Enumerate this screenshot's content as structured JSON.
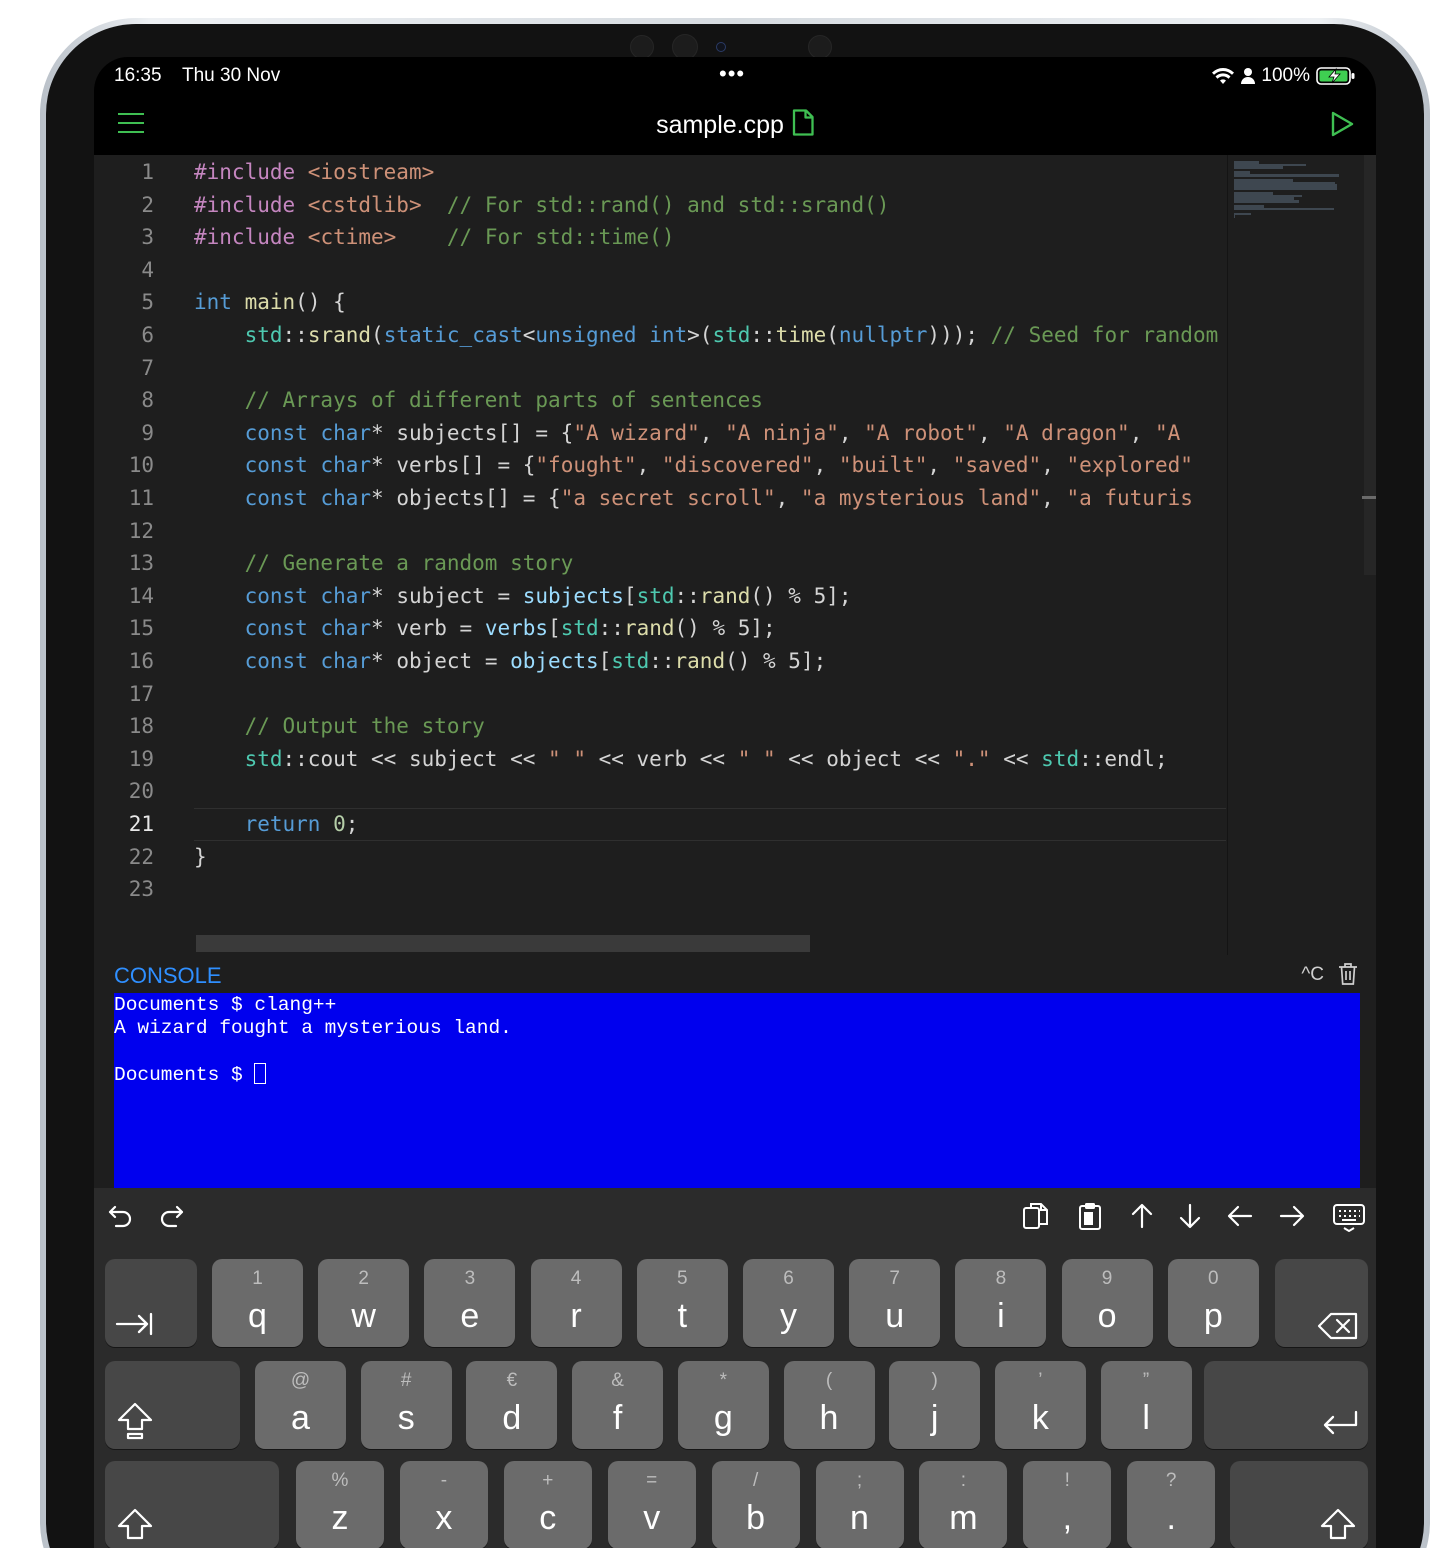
{
  "status": {
    "time": "16:35",
    "date": "Thu 30 Nov",
    "battery": "100%",
    "dots": "•••"
  },
  "header": {
    "file_name": "sample.cpp"
  },
  "editor": {
    "lines": [
      [
        [
          "pp",
          "#include "
        ],
        [
          "inc",
          "<iostream>"
        ]
      ],
      [
        [
          "pp",
          "#include "
        ],
        [
          "inc",
          "<cstdlib>"
        ],
        [
          "",
          "  "
        ],
        [
          "cm",
          "// For std::rand() and std::srand()"
        ]
      ],
      [
        [
          "pp",
          "#include "
        ],
        [
          "inc",
          "<ctime>"
        ],
        [
          "",
          "    "
        ],
        [
          "cm",
          "// For std::time()"
        ]
      ],
      [],
      [
        [
          "kw",
          "int"
        ],
        [
          "",
          " "
        ],
        [
          "fn",
          "main"
        ],
        [
          "",
          "() {"
        ]
      ],
      [
        [
          "",
          "    "
        ],
        [
          "ty",
          "std"
        ],
        [
          "",
          "::"
        ],
        [
          "fn",
          "srand"
        ],
        [
          "",
          "("
        ],
        [
          "kw",
          "static_cast"
        ],
        [
          "",
          "<"
        ],
        [
          "kw",
          "unsigned int"
        ],
        [
          "",
          ">("
        ],
        [
          "ty",
          "std"
        ],
        [
          "",
          "::"
        ],
        [
          "fn",
          "time"
        ],
        [
          "",
          "("
        ],
        [
          "kw",
          "nullptr"
        ],
        [
          "",
          ")));"
        ],
        [
          "",
          " "
        ],
        [
          "cm",
          "// Seed for random"
        ]
      ],
      [],
      [
        [
          "",
          "    "
        ],
        [
          "cm",
          "// Arrays of different parts of sentences"
        ]
      ],
      [
        [
          "",
          "    "
        ],
        [
          "kw",
          "const"
        ],
        [
          "",
          " "
        ],
        [
          "kw",
          "char"
        ],
        [
          "",
          "* subjects[] = {"
        ],
        [
          "st",
          "\"A wizard\""
        ],
        [
          "",
          ", "
        ],
        [
          "st",
          "\"A ninja\""
        ],
        [
          "",
          ", "
        ],
        [
          "st",
          "\"A robot\""
        ],
        [
          "",
          ", "
        ],
        [
          "st",
          "\"A dragon\""
        ],
        [
          "",
          ", "
        ],
        [
          "st",
          "\"A"
        ]
      ],
      [
        [
          "",
          "    "
        ],
        [
          "kw",
          "const"
        ],
        [
          "",
          " "
        ],
        [
          "kw",
          "char"
        ],
        [
          "",
          "* verbs[] = {"
        ],
        [
          "st",
          "\"fought\""
        ],
        [
          "",
          ", "
        ],
        [
          "st",
          "\"discovered\""
        ],
        [
          "",
          ", "
        ],
        [
          "st",
          "\"built\""
        ],
        [
          "",
          ", "
        ],
        [
          "st",
          "\"saved\""
        ],
        [
          "",
          ", "
        ],
        [
          "st",
          "\"explored\""
        ]
      ],
      [
        [
          "",
          "    "
        ],
        [
          "kw",
          "const"
        ],
        [
          "",
          " "
        ],
        [
          "kw",
          "char"
        ],
        [
          "",
          "* objects[] = {"
        ],
        [
          "st",
          "\"a secret scroll\""
        ],
        [
          "",
          ", "
        ],
        [
          "st",
          "\"a mysterious land\""
        ],
        [
          "",
          ", "
        ],
        [
          "st",
          "\"a futuris"
        ]
      ],
      [],
      [
        [
          "",
          "    "
        ],
        [
          "cm",
          "// Generate a random story"
        ]
      ],
      [
        [
          "",
          "    "
        ],
        [
          "kw",
          "const"
        ],
        [
          "",
          " "
        ],
        [
          "kw",
          "char"
        ],
        [
          "",
          "* subject = "
        ],
        [
          "va",
          "subjects"
        ],
        [
          "",
          "["
        ],
        [
          "ty",
          "std"
        ],
        [
          "",
          "::"
        ],
        [
          "fn",
          "rand"
        ],
        [
          "",
          "() % 5];"
        ]
      ],
      [
        [
          "",
          "    "
        ],
        [
          "kw",
          "const"
        ],
        [
          "",
          " "
        ],
        [
          "kw",
          "char"
        ],
        [
          "",
          "* verb = "
        ],
        [
          "va",
          "verbs"
        ],
        [
          "",
          "["
        ],
        [
          "ty",
          "std"
        ],
        [
          "",
          "::"
        ],
        [
          "fn",
          "rand"
        ],
        [
          "",
          "() % 5];"
        ]
      ],
      [
        [
          "",
          "    "
        ],
        [
          "kw",
          "const"
        ],
        [
          "",
          " "
        ],
        [
          "kw",
          "char"
        ],
        [
          "",
          "* object = "
        ],
        [
          "va",
          "objects"
        ],
        [
          "",
          "["
        ],
        [
          "ty",
          "std"
        ],
        [
          "",
          "::"
        ],
        [
          "fn",
          "rand"
        ],
        [
          "",
          "() % 5];"
        ]
      ],
      [],
      [
        [
          "",
          "    "
        ],
        [
          "cm",
          "// Output the story"
        ]
      ],
      [
        [
          "",
          "    "
        ],
        [
          "ty",
          "std"
        ],
        [
          "",
          "::cout << subject << "
        ],
        [
          "st",
          "\" \""
        ],
        [
          "",
          " << verb << "
        ],
        [
          "st",
          "\" \""
        ],
        [
          "",
          " << object << "
        ],
        [
          "st",
          "\".\""
        ],
        [
          "",
          " << "
        ],
        [
          "ty",
          "std"
        ],
        [
          "",
          "::endl;"
        ]
      ],
      [],
      [
        [
          "",
          "    "
        ],
        [
          "kw",
          "return"
        ],
        [
          "",
          " "
        ],
        [
          "nu",
          "0"
        ],
        [
          "",
          ";"
        ]
      ],
      [
        [
          "",
          "}"
        ]
      ],
      []
    ],
    "current_line": 21
  },
  "console": {
    "label": "CONSOLE",
    "interrupt": "^C",
    "output": [
      "Documents $ clang++",
      "A wizard fought a mysterious land.",
      "",
      "Documents $ "
    ]
  },
  "keyboard": {
    "row1": [
      [
        "1",
        "q"
      ],
      [
        "2",
        "w"
      ],
      [
        "3",
        "e"
      ],
      [
        "4",
        "r"
      ],
      [
        "5",
        "t"
      ],
      [
        "6",
        "y"
      ],
      [
        "7",
        "u"
      ],
      [
        "8",
        "i"
      ],
      [
        "9",
        "o"
      ],
      [
        "0",
        "p"
      ]
    ],
    "row2": [
      [
        "@",
        "a"
      ],
      [
        "#",
        "s"
      ],
      [
        "€",
        "d"
      ],
      [
        "&",
        "f"
      ],
      [
        "*",
        "g"
      ],
      [
        "(",
        "h"
      ],
      [
        ")",
        "j"
      ],
      [
        "’",
        "k"
      ],
      [
        "”",
        "l"
      ]
    ],
    "row3": [
      [
        "%",
        "z"
      ],
      [
        "-",
        "x"
      ],
      [
        "+",
        "c"
      ],
      [
        "=",
        "v"
      ],
      [
        "/",
        "b"
      ],
      [
        ";",
        "n"
      ],
      [
        ":",
        "m"
      ],
      [
        "!",
        ","
      ],
      [
        "?",
        "."
      ]
    ]
  },
  "colors": {
    "accent_green": "#3fbf52",
    "console_label": "#2f8fff",
    "terminal_bg": "#0000ee",
    "editor_bg": "#1e1e1e"
  }
}
